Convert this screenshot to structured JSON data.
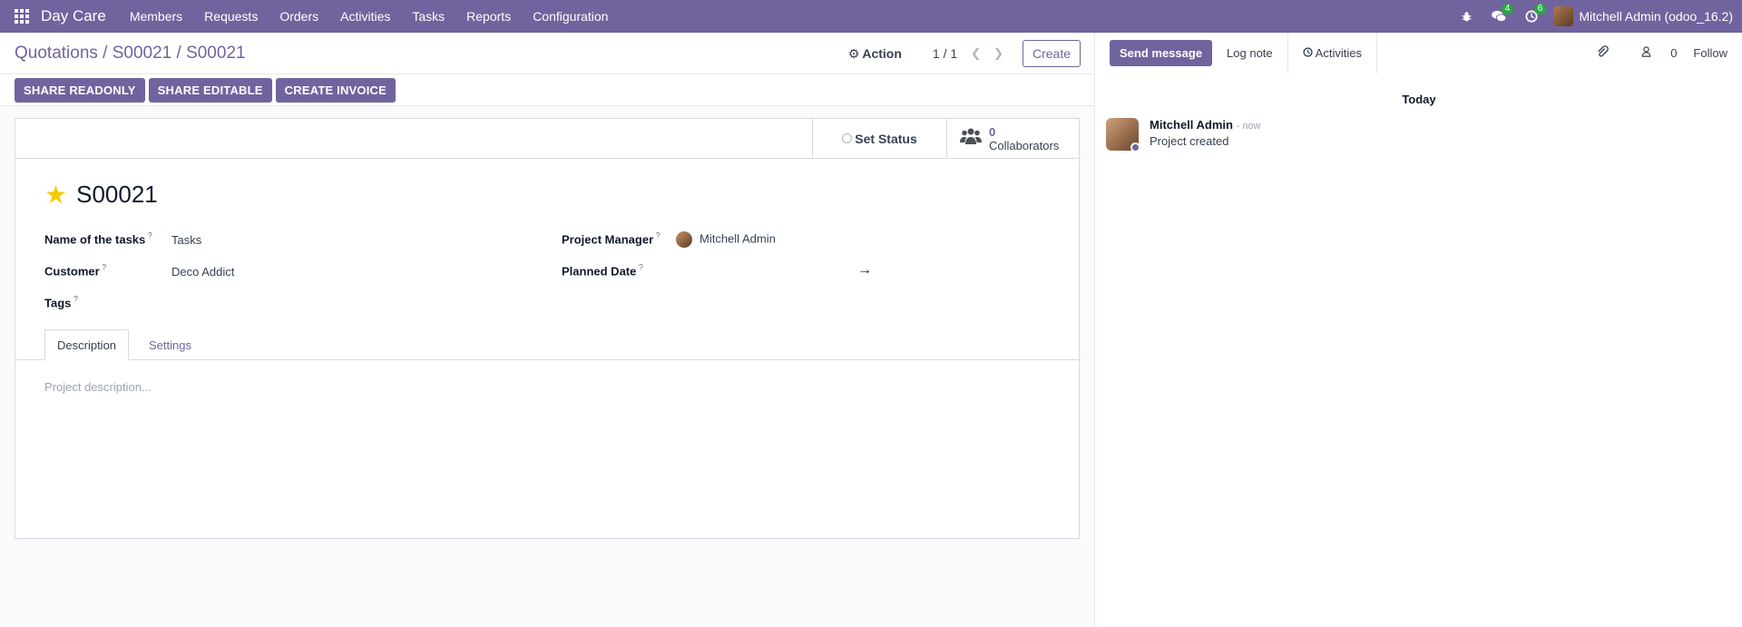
{
  "navbar": {
    "brand": "Day Care",
    "menu": [
      "Members",
      "Requests",
      "Orders",
      "Activities",
      "Tasks",
      "Reports",
      "Configuration"
    ],
    "messages_badge": "4",
    "activities_badge": "6",
    "user": "Mitchell Admin (odoo_16.2)"
  },
  "control_panel": {
    "breadcrumb": "Quotations / S00021 / S00021",
    "action_label": "Action",
    "pager": "1 / 1",
    "create_label": "Create"
  },
  "statusbar": {
    "buttons": [
      "SHARE READONLY",
      "SHARE EDITABLE",
      "CREATE INVOICE"
    ]
  },
  "sheet": {
    "set_status_label": "Set Status",
    "collaborators_count": "0",
    "collaborators_label": "Collaborators",
    "title": "S00021",
    "fields": {
      "tasks_label": "Name of the tasks",
      "tasks_value": "Tasks",
      "customer_label": "Customer",
      "customer_value": "Deco Addict",
      "tags_label": "Tags",
      "manager_label": "Project Manager",
      "manager_value": "Mitchell Admin",
      "planned_label": "Planned Date",
      "planned_arrow": "→"
    },
    "tabs": [
      "Description",
      "Settings"
    ],
    "description_placeholder": "Project description..."
  },
  "chatter": {
    "send_message": "Send message",
    "log_note": "Log note",
    "activities": "Activities",
    "followers_count": "0",
    "follow": "Follow",
    "day_separator": "Today",
    "message": {
      "author": "Mitchell Admin",
      "time": "- now",
      "body": "Project created"
    }
  }
}
